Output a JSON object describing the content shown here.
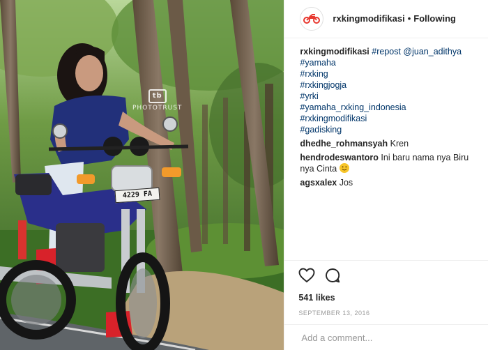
{
  "header": {
    "username": "rxkingmodifikasi",
    "separator": "•",
    "follow_status": "Following",
    "avatar_icon": "motorcycle-icon"
  },
  "photo": {
    "watermark_text": "PHOTOTRUST",
    "watermark_logo": "tb",
    "plate_text": "4229 FA"
  },
  "caption": {
    "username": "rxkingmodifikasi",
    "repost": "#repost",
    "mention": "@juan_adithya",
    "hashtags": [
      "#yamaha",
      "#rxking",
      "#rxkingjogja",
      "#yrki",
      "#yamaha_rxking_indonesia",
      "#rxkingmodifikasi",
      "#gadisking"
    ]
  },
  "comments": [
    {
      "username": "dhedhe_rohmansyah",
      "text": "Kren"
    },
    {
      "username": "hendrodeswantoro",
      "text": "Ini baru nama nya Biru nya Cinta",
      "emoji": "smiling-face-emoji"
    },
    {
      "username": "agsxalex",
      "text": "Jos"
    }
  ],
  "actions": {
    "like_icon": "heart-icon",
    "comment_icon": "comment-icon",
    "likes": "541 likes",
    "date": "SEPTEMBER 13, 2016"
  },
  "add_comment": {
    "placeholder": "Add a comment..."
  },
  "colors": {
    "link": "#003569",
    "text": "#262626",
    "muted": "#999999",
    "divider": "#efefef",
    "brand_red": "#e8382f"
  }
}
